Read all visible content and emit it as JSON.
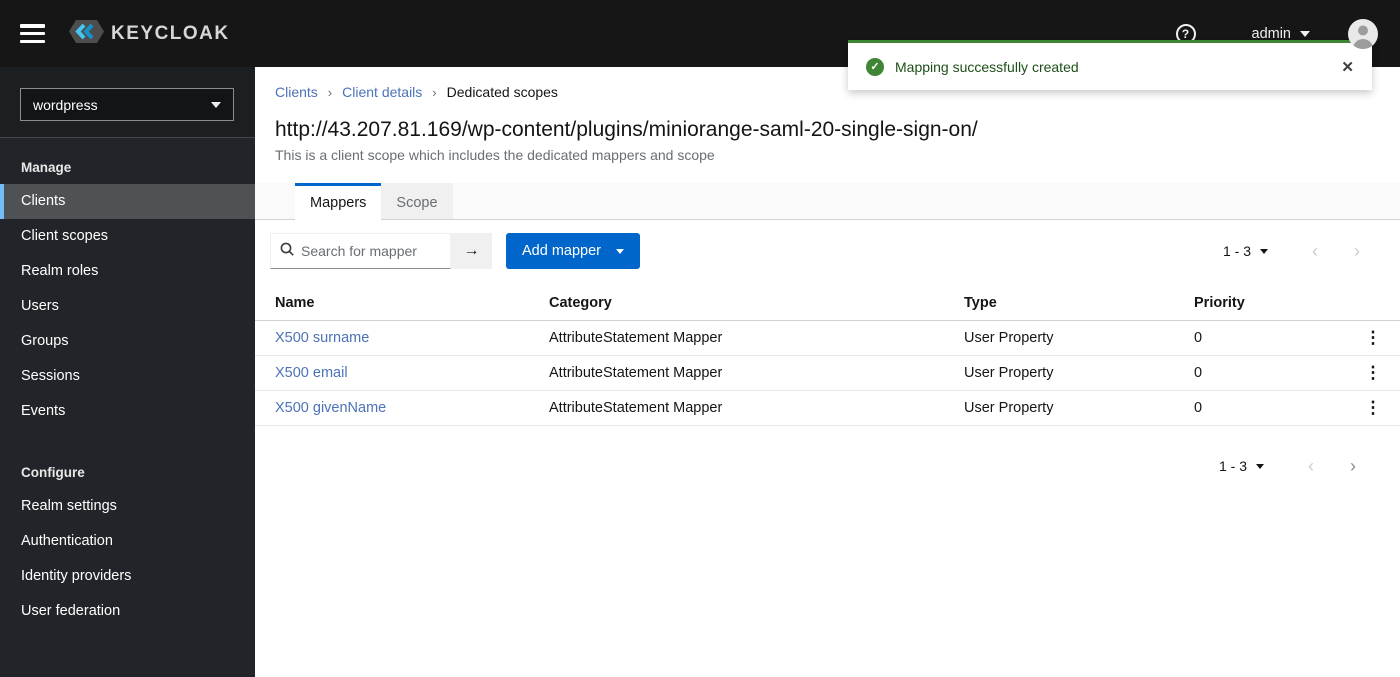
{
  "masthead": {
    "brand": "KEYCLOAK",
    "username": "admin"
  },
  "toast": {
    "message": "Mapping successfully created"
  },
  "sidebar": {
    "realm": "wordpress",
    "sections": [
      {
        "label": "Manage",
        "items": [
          "Clients",
          "Client scopes",
          "Realm roles",
          "Users",
          "Groups",
          "Sessions",
          "Events"
        ],
        "active_item": "Clients"
      },
      {
        "label": "Configure",
        "items": [
          "Realm settings",
          "Authentication",
          "Identity providers",
          "User federation"
        ]
      }
    ]
  },
  "breadcrumb": {
    "items": [
      "Clients",
      "Client details",
      "Dedicated scopes"
    ]
  },
  "page": {
    "title": "http://43.207.81.169/wp-content/plugins/miniorange-saml-20-single-sign-on/",
    "subtitle": "This is a client scope which includes the dedicated mappers and scope"
  },
  "tabs": [
    {
      "label": "Mappers",
      "active": true
    },
    {
      "label": "Scope",
      "active": false
    }
  ],
  "toolbar": {
    "search_placeholder": "Search for mapper",
    "add_label": "Add mapper",
    "pagination_range": "1 - 3"
  },
  "table": {
    "columns": [
      "Name",
      "Category",
      "Type",
      "Priority"
    ],
    "rows": [
      {
        "name": "X500 surname",
        "category": "AttributeStatement Mapper",
        "type": "User Property",
        "priority": "0"
      },
      {
        "name": "X500 email",
        "category": "AttributeStatement Mapper",
        "type": "User Property",
        "priority": "0"
      },
      {
        "name": "X500 givenName",
        "category": "AttributeStatement Mapper",
        "type": "User Property",
        "priority": "0"
      }
    ]
  },
  "footer": {
    "pagination_range": "1 - 3"
  },
  "icons": {
    "help": "?",
    "check": "✓",
    "close": "✕",
    "arrow": "→",
    "kebab": "⋮",
    "prev": "‹",
    "next": "›"
  },
  "colors": {
    "accent_blue": "#0066cc",
    "success_green": "#3e8635",
    "link_blue": "#4c72b8",
    "active_nav_border": "#73bcf7",
    "masthead_bg": "#161616",
    "sidebar_bg": "#212428"
  }
}
